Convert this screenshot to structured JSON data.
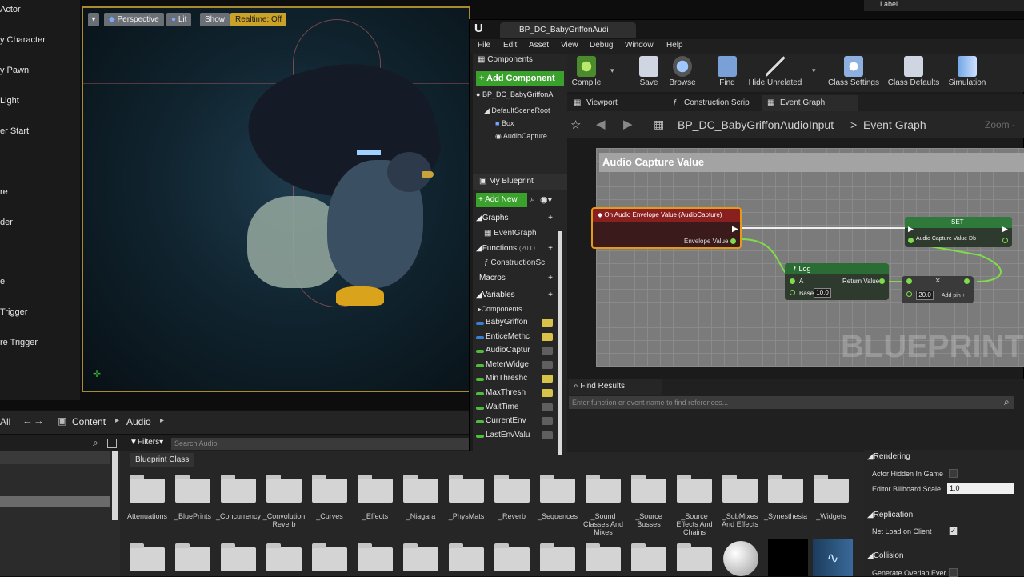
{
  "place_actors": {
    "items": [
      "Actor",
      "y Character",
      "y Pawn",
      "Light",
      "er Start",
      "",
      "re",
      "der",
      "",
      "e",
      "Trigger",
      "re Trigger"
    ]
  },
  "viewport": {
    "menu_icon": "chevron-down-icon",
    "perspective": "Perspective",
    "lit": "Lit",
    "show": "Show",
    "realtime": "Realtime: Off"
  },
  "content_browser": {
    "all": "All",
    "path": [
      "Content",
      "Audio"
    ],
    "filters": "Filters",
    "search_placeholder": "Search Audio",
    "blueprint_class": "Blueprint Class",
    "folders_row1": [
      "Attenuations",
      "_BluePrints",
      "_Concurrency",
      "_Convolution Reverb",
      "_Curves",
      "_Effects",
      "_Niagara",
      "_PhysMats",
      "_Reverb",
      "_Sequences",
      "_Sound Classes And Mixes",
      "_Source Busses",
      "_Source Effects And Chains",
      "_SubMixes And Effects",
      "_Synesthesia",
      "_Widgets"
    ]
  },
  "blueprint": {
    "tab": "BP_DC_BabyGriffonAudi",
    "menu": [
      "File",
      "Edit",
      "Asset",
      "View",
      "Debug",
      "Window",
      "Help"
    ],
    "components_title": "Components",
    "add_component": "+ Add Component",
    "root": "BP_DC_BabyGriffonA",
    "tree": [
      "DefaultSceneRoot",
      "Box",
      "AudioCapture"
    ],
    "my_blueprint": "My Blueprint",
    "add_new": "+ Add New",
    "graphs": "Graphs",
    "event_graph_item": "EventGraph",
    "functions": "Functions",
    "functions_count": "(20 O",
    "construction_item": "ConstructionSc",
    "macros": "Macros",
    "variables": "Variables",
    "components_cat": "Components",
    "vars": [
      "BabyGriffon",
      "EnticeMethc",
      "AudioCaptur",
      "MeterWidge",
      "MinThreshc",
      "MaxThresh",
      "WaitTime",
      "CurrentEnv",
      "LastEnvValu"
    ],
    "toolbar": [
      "Compile",
      "Save",
      "Browse",
      "Find",
      "Hide Unrelated",
      "Class Settings",
      "Class Defaults",
      "Simulation"
    ],
    "graph_tabs": [
      "Viewport",
      "Construction Scrip",
      "Event Graph"
    ],
    "breadcrumb_root": "BP_DC_BabyGriffonAudioInput",
    "breadcrumb_leaf": "Event Graph",
    "zoom": "Zoom -",
    "comment_title": "Audio Capture Value",
    "event_node": "On Audio Envelope Value (AudioCapture)",
    "envelope_pin": "Envelope Value",
    "log_node": "Log",
    "log_a": "A",
    "log_base": "Base",
    "log_base_value": "10.0",
    "return_value": "Return Value",
    "add_value": "20.0",
    "add_pin": "Add pin",
    "set_node": "SET",
    "set_var": "Audio Capture Value Db",
    "watermark": "BLUEPRINT",
    "find_results": "Find Results",
    "find_placeholder": "Enter function or event name to find references..."
  },
  "details": {
    "label": "Label",
    "rendering": "Rendering",
    "actor_hidden": "Actor Hidden In Game",
    "billboard_scale": "Editor Billboard Scale",
    "billboard_value": "1.0",
    "replication": "Replication",
    "net_load": "Net Load on Client",
    "collision": "Collision",
    "generate_overlap": "Generate Overlap Ever"
  },
  "colors": {
    "accent_green": "#4fbf3b",
    "realtime_yellow": "#c9a227",
    "event_red": "#8a1f1f"
  }
}
